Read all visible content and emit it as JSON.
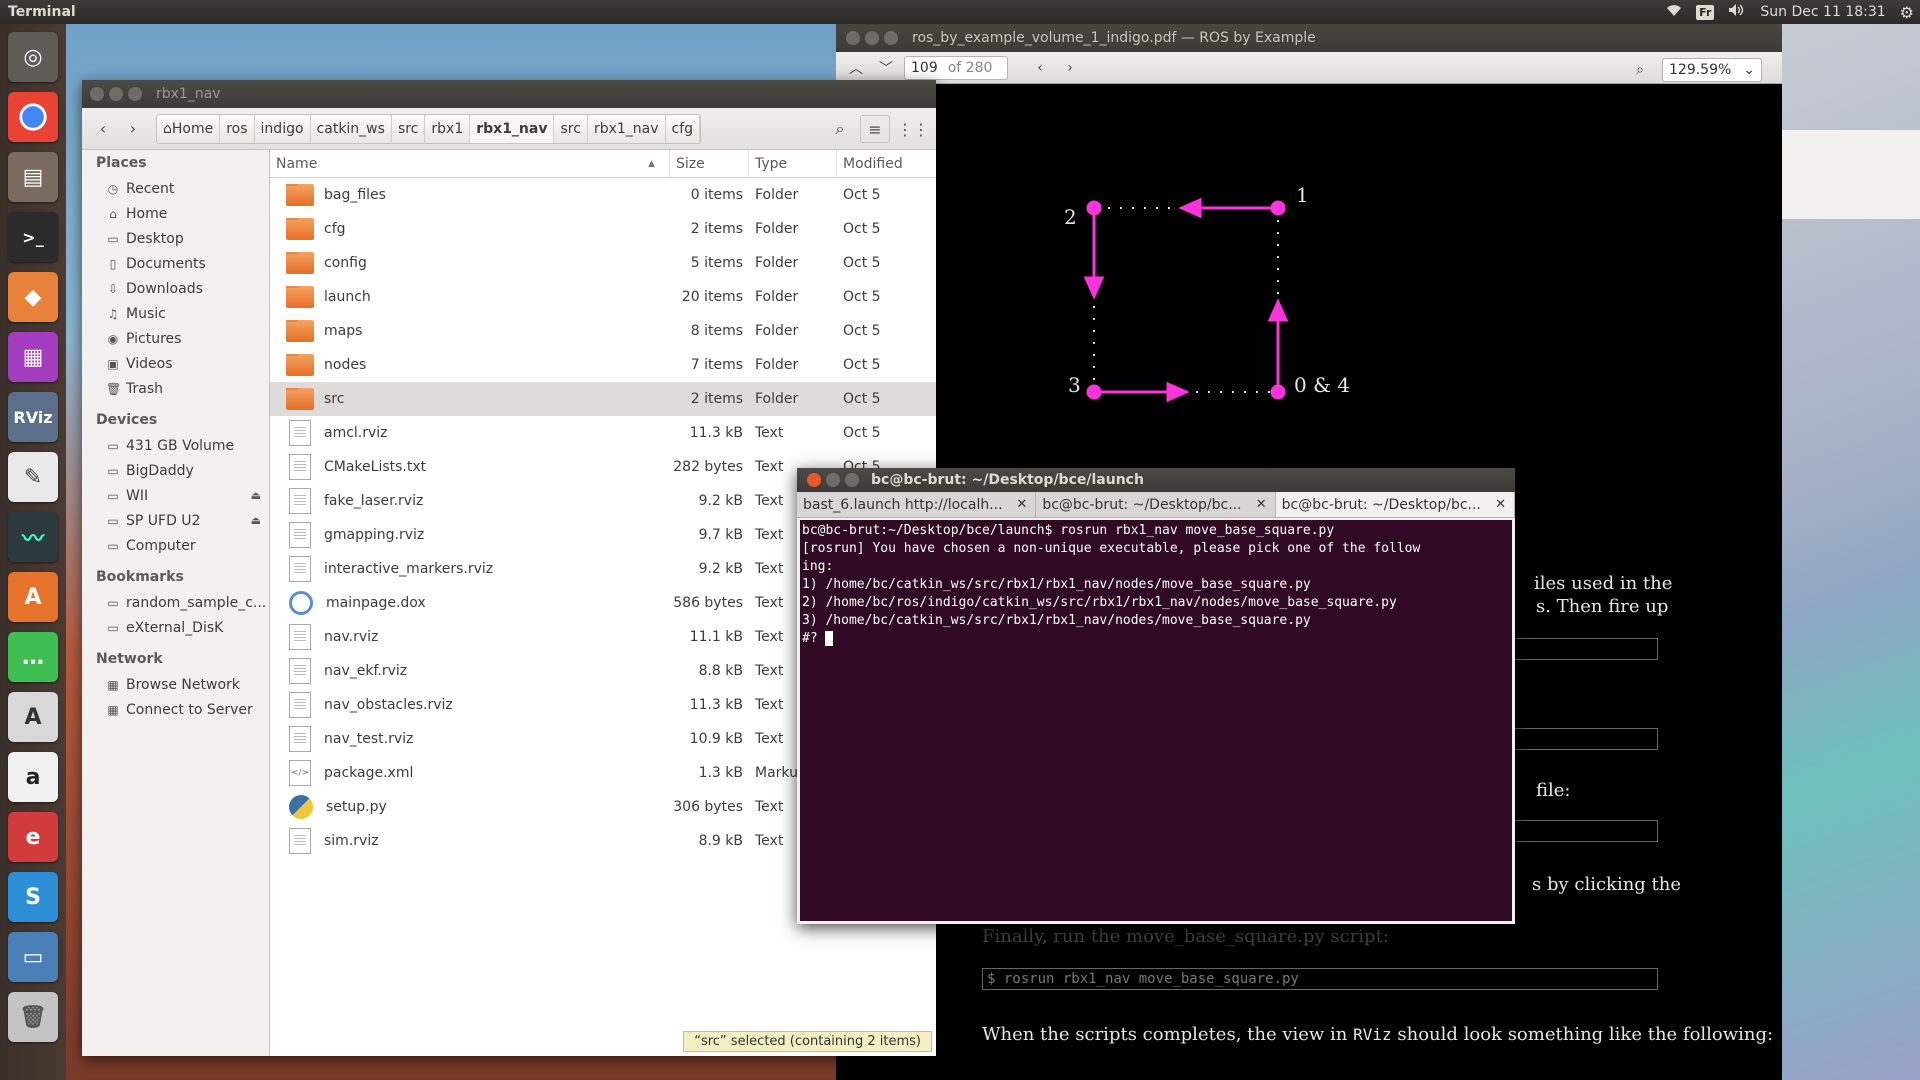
{
  "top_panel": {
    "app_title": "Terminal",
    "keyboard": "Fr",
    "clock": "Sun Dec 11 18:31"
  },
  "launcher": {
    "items": [
      "ubuntu-dash",
      "chrome",
      "files",
      "terminal",
      "sublime",
      "workspaces",
      "rviz",
      "text-editor",
      "system-monitor",
      "software-center",
      "messaging",
      "updater",
      "amazon",
      "pdf-viewer",
      "skype",
      "storage",
      "trash"
    ]
  },
  "pdf": {
    "title": "ros_by_example_volume_1_indigo.pdf — ROS by Example",
    "page": "109",
    "of_pages": "of 280",
    "zoom": "129.59%",
    "figure_labels": {
      "p1": "1",
      "p2": "2",
      "p3": "3",
      "p04": "0 & 4"
    },
    "line1": "iles used in the",
    "line2": "s.  Then fire up",
    "line3": "file:",
    "line4": "s by clicking the",
    "line5": "Finally, run the move_base_square.py script:",
    "code": "$ rosrun rbx1_nav move_base_square.py",
    "final_pre": "When the scripts completes, the view in ",
    "final_code": "RViz",
    "final_post": " should look something like the following:"
  },
  "fm": {
    "title": "rbx1_nav",
    "breadcrumbs": [
      "Home",
      "ros",
      "indigo",
      "catkin_ws",
      "src",
      "rbx1",
      "rbx1_nav",
      "src",
      "rbx1_nav",
      "cfg"
    ],
    "sidebar": {
      "places_header": "Places",
      "places": [
        "Recent",
        "Home",
        "Desktop",
        "Documents",
        "Downloads",
        "Music",
        "Pictures",
        "Videos",
        "Trash"
      ],
      "devices_header": "Devices",
      "devices": [
        "431 GB Volume",
        "BigDaddy",
        "WII",
        "SP UFD U2",
        "Computer"
      ],
      "bookmarks_header": "Bookmarks",
      "bookmarks": [
        "random_sample_c...",
        "eXternal_DisK"
      ],
      "network_header": "Network",
      "network": [
        "Browse Network",
        "Connect to Server"
      ]
    },
    "columns": {
      "name": "Name",
      "size": "Size",
      "type": "Type",
      "modified": "Modified"
    },
    "files": [
      {
        "name": "bag_files",
        "size": "0 items",
        "type": "Folder",
        "modified": "Oct 5",
        "kind": "folder"
      },
      {
        "name": "cfg",
        "size": "2 items",
        "type": "Folder",
        "modified": "Oct 5",
        "kind": "folder"
      },
      {
        "name": "config",
        "size": "5 items",
        "type": "Folder",
        "modified": "Oct 5",
        "kind": "folder"
      },
      {
        "name": "launch",
        "size": "20 items",
        "type": "Folder",
        "modified": "Oct 5",
        "kind": "folder"
      },
      {
        "name": "maps",
        "size": "8 items",
        "type": "Folder",
        "modified": "Oct 5",
        "kind": "folder"
      },
      {
        "name": "nodes",
        "size": "7 items",
        "type": "Folder",
        "modified": "Oct 5",
        "kind": "folder"
      },
      {
        "name": "src",
        "size": "2 items",
        "type": "Folder",
        "modified": "Oct 5",
        "kind": "folder",
        "selected": true
      },
      {
        "name": "amcl.rviz",
        "size": "11.3 kB",
        "type": "Text",
        "modified": "Oct 5",
        "kind": "text"
      },
      {
        "name": "CMakeLists.txt",
        "size": "282 bytes",
        "type": "Text",
        "modified": "Oct 5",
        "kind": "text"
      },
      {
        "name": "fake_laser.rviz",
        "size": "9.2 kB",
        "type": "Text",
        "modified": "",
        "kind": "text"
      },
      {
        "name": "gmapping.rviz",
        "size": "9.7 kB",
        "type": "Text",
        "modified": "",
        "kind": "text"
      },
      {
        "name": "interactive_markers.rviz",
        "size": "9.2 kB",
        "type": "Text",
        "modified": "",
        "kind": "text"
      },
      {
        "name": "mainpage.dox",
        "size": "586 bytes",
        "type": "Text",
        "modified": "",
        "kind": "dox"
      },
      {
        "name": "nav.rviz",
        "size": "11.1 kB",
        "type": "Text",
        "modified": "",
        "kind": "text"
      },
      {
        "name": "nav_ekf.rviz",
        "size": "8.8 kB",
        "type": "Text",
        "modified": "",
        "kind": "text"
      },
      {
        "name": "nav_obstacles.rviz",
        "size": "11.3 kB",
        "type": "Text",
        "modified": "",
        "kind": "text"
      },
      {
        "name": "nav_test.rviz",
        "size": "10.9 kB",
        "type": "Text",
        "modified": "",
        "kind": "text"
      },
      {
        "name": "package.xml",
        "size": "1.3 kB",
        "type": "Marku",
        "modified": "",
        "kind": "xml"
      },
      {
        "name": "setup.py",
        "size": "306 bytes",
        "type": "Text",
        "modified": "",
        "kind": "py"
      },
      {
        "name": "sim.rviz",
        "size": "8.9 kB",
        "type": "Text",
        "modified": "",
        "kind": "text"
      }
    ],
    "status": "“src” selected  (containing 2 items)"
  },
  "terminal": {
    "title": "bc@bc-brut: ~/Desktop/bce/launch",
    "tabs": [
      "bast_6.launch http://localh...",
      "bc@bc-brut: ~/Desktop/bc...",
      "bc@bc-brut: ~/Desktop/bc..."
    ],
    "lines": [
      "bc@bc-brut:~/Desktop/bce/launch$ rosrun rbx1_nav move_base_square.py",
      "[rosrun] You have chosen a non-unique executable, please pick one of the follow",
      "ing:",
      "1) /home/bc/catkin_ws/src/rbx1/rbx1_nav/nodes/move_base_square.py",
      "2) /home/bc/ros/indigo/catkin_ws/src/rbx1/rbx1_nav/nodes/move_base_square.py",
      "3) /home/bc/catkin_ws/src/rbx1/rbx1_nav/nodes/move_base_square.py",
      "#? "
    ]
  },
  "colors": {
    "terminal_bg": "#300a24",
    "accent_orange": "#e76f26",
    "figure_magenta": "#ff33dd"
  }
}
